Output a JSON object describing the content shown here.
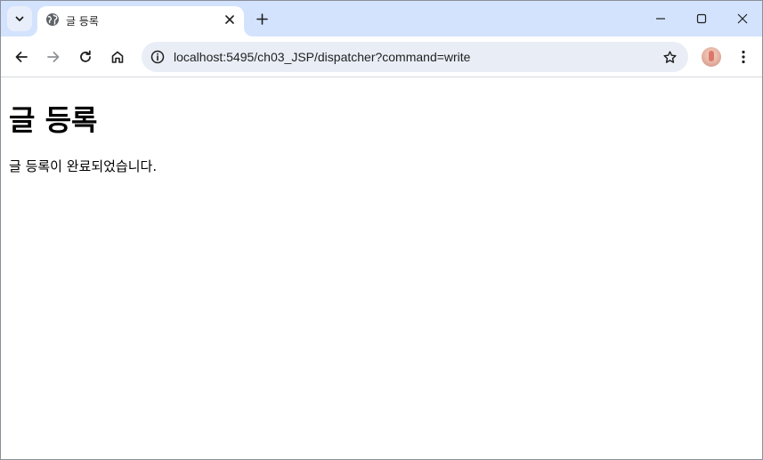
{
  "browser": {
    "tab": {
      "title": "글 등록",
      "favicon": "globe-icon"
    },
    "address_bar": {
      "url": "localhost:5495/ch03_JSP/dispatcher?command=write"
    },
    "icons": {
      "tab_search": "chevron-down-icon",
      "tab_close": "close-icon",
      "new_tab": "plus-icon",
      "minimize": "minimize-icon",
      "maximize": "maximize-icon",
      "close": "close-icon",
      "back": "arrow-left-icon",
      "forward": "arrow-right-icon",
      "reload": "reload-icon",
      "home": "home-icon",
      "site_info": "info-icon",
      "bookmark": "star-icon",
      "menu": "kebab-menu-icon"
    },
    "colors": {
      "tabstrip": "#d3e3fd",
      "omnibox": "#e9eef6"
    }
  },
  "page": {
    "heading": "글 등록",
    "message": "글 등록이 완료되었습니다."
  }
}
